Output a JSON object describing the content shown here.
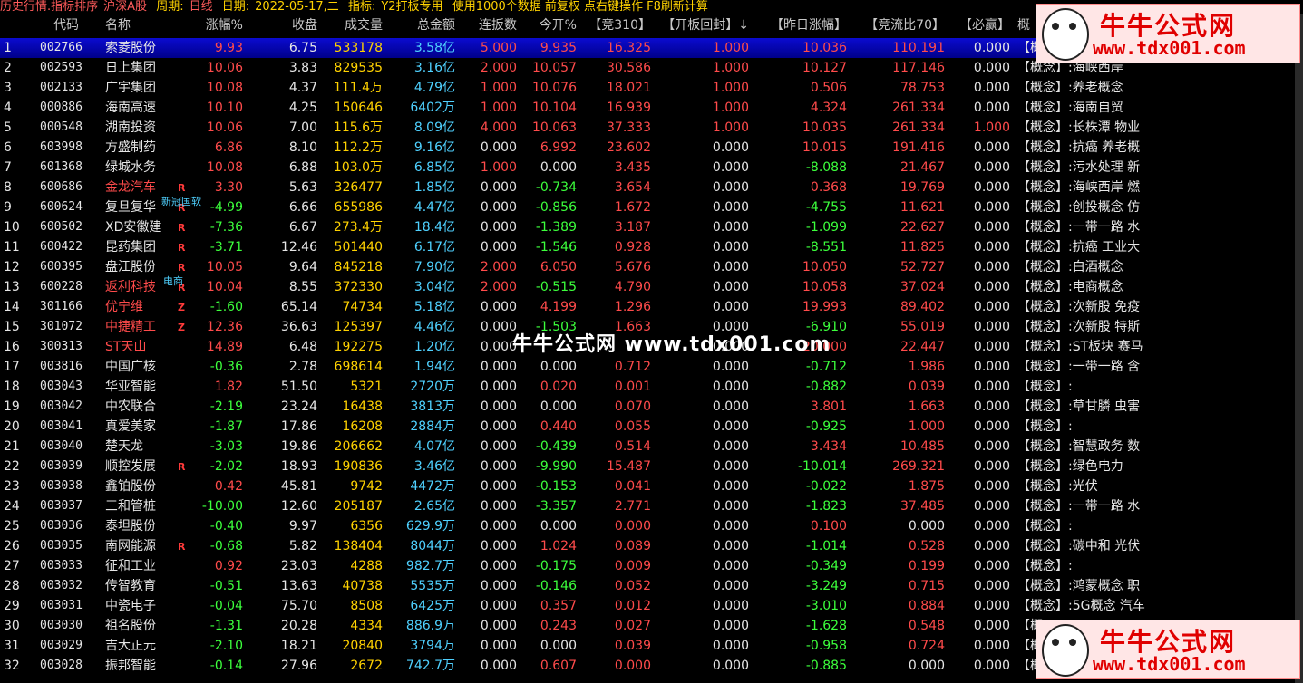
{
  "topbar": {
    "crumb": "历史行情.指标排序",
    "market": "沪深A股",
    "period_label": "周期:",
    "period_value": "日线",
    "date_label": "日期:",
    "date_value": "2022-05-17,二",
    "indicator_label": "指标:",
    "indicator_value": "Y2打板专用",
    "hint": "使用1000个数据 前复权 点右键操作 F8刷新计算"
  },
  "columns": [
    "代码",
    "名称",
    "涨幅%",
    "收盘",
    "成交量",
    "总金额",
    "连扳数",
    "今开%",
    "【竞310】",
    "【开板回封】↓",
    "【昨日涨幅】",
    "【竞流比70】",
    "【必赢】",
    "概"
  ],
  "rows": [
    [
      "1",
      "002766",
      "索菱股份",
      "9.93",
      "6.75",
      "533178",
      "3.58亿",
      "5.000",
      "9.935",
      "16.325",
      "1.000",
      "10.036",
      "110.191",
      "0.000",
      "【概"
    ],
    [
      "2",
      "002593",
      "日上集团",
      "10.06",
      "3.83",
      "829535",
      "3.16亿",
      "2.000",
      "10.057",
      "30.586",
      "1.000",
      "10.127",
      "117.146",
      "0.000",
      "【概念】:海峡西岸"
    ],
    [
      "3",
      "002133",
      "广宇集团",
      "10.08",
      "4.37",
      "111.4万",
      "4.79亿",
      "1.000",
      "10.076",
      "18.021",
      "1.000",
      "0.506",
      "78.753",
      "0.000",
      "【概念】:养老概念"
    ],
    [
      "4",
      "000886",
      "海南高速",
      "10.10",
      "4.25",
      "150646",
      "6402万",
      "1.000",
      "10.104",
      "16.939",
      "1.000",
      "4.324",
      "261.334",
      "0.000",
      "【概念】:海南自贸"
    ],
    [
      "5",
      "000548",
      "湖南投资",
      "10.06",
      "7.00",
      "115.6万",
      "8.09亿",
      "4.000",
      "10.063",
      "37.333",
      "1.000",
      "10.035",
      "261.334",
      "1.000",
      "【概念】:长株潭 物业"
    ],
    [
      "6",
      "603998",
      "方盛制药",
      "6.86",
      "8.10",
      "112.2万",
      "9.16亿",
      "0.000",
      "6.992",
      "23.602",
      "0.000",
      "10.015",
      "191.416",
      "0.000",
      "【概念】:抗癌 养老概"
    ],
    [
      "7",
      "601368",
      "绿城水务",
      "10.08",
      "6.88",
      "103.0万",
      "6.85亿",
      "1.000",
      "0.000",
      "3.435",
      "0.000",
      "-8.088",
      "21.467",
      "0.000",
      "【概念】:污水处理 新"
    ],
    [
      "8",
      "600686",
      "金龙汽车",
      "3.30",
      "5.63",
      "326477",
      "1.85亿",
      "0.000",
      "-0.734",
      "3.654",
      "0.000",
      "0.368",
      "19.769",
      "0.000",
      "【概念】:海峡西岸 燃"
    ],
    [
      "9",
      "600624",
      "复旦复华",
      "-4.99",
      "6.66",
      "655986",
      "4.47亿",
      "0.000",
      "-0.856",
      "1.672",
      "0.000",
      "-4.755",
      "11.621",
      "0.000",
      "【概念】:创投概念 仿"
    ],
    [
      "10",
      "600502",
      "XD安徽建",
      "-7.36",
      "6.67",
      "273.4万",
      "18.4亿",
      "0.000",
      "-1.389",
      "3.187",
      "0.000",
      "-1.099",
      "22.627",
      "0.000",
      "【概念】:一带一路 水"
    ],
    [
      "11",
      "600422",
      "昆药集团",
      "-3.71",
      "12.46",
      "501440",
      "6.17亿",
      "0.000",
      "-1.546",
      "0.928",
      "0.000",
      "-8.551",
      "11.825",
      "0.000",
      "【概念】:抗癌 工业大"
    ],
    [
      "12",
      "600395",
      "盘江股份",
      "10.05",
      "9.64",
      "845218",
      "7.90亿",
      "2.000",
      "6.050",
      "5.676",
      "0.000",
      "10.050",
      "52.727",
      "0.000",
      "【概念】:白酒概念"
    ],
    [
      "13",
      "600228",
      "返利科技",
      "10.04",
      "8.55",
      "372330",
      "3.04亿",
      "2.000",
      "-0.515",
      "4.790",
      "0.000",
      "10.058",
      "37.024",
      "0.000",
      "【概念】:电商概念"
    ],
    [
      "14",
      "301166",
      "优宁维",
      "-1.60",
      "65.14",
      "74734",
      "5.18亿",
      "0.000",
      "4.199",
      "1.296",
      "0.000",
      "19.993",
      "89.402",
      "0.000",
      "【概念】:次新股 免疫"
    ],
    [
      "15",
      "301072",
      "中捷精工",
      "12.36",
      "36.63",
      "125397",
      "4.46亿",
      "0.000",
      "-1.503",
      "1.663",
      "0.000",
      "-6.910",
      "55.019",
      "0.000",
      "【概念】:次新股 特斯"
    ],
    [
      "16",
      "300313",
      "ST天山",
      "14.89",
      "6.48",
      "192275",
      "1.20亿",
      "0.000",
      "",
      "",
      "0.000",
      "20.000",
      "22.447",
      "0.000",
      "【概念】:ST板块 赛马"
    ],
    [
      "17",
      "003816",
      "中国广核",
      "-0.36",
      "2.78",
      "698614",
      "1.94亿",
      "0.000",
      "0.000",
      "0.712",
      "0.000",
      "-0.712",
      "1.986",
      "0.000",
      "【概念】:一带一路 含"
    ],
    [
      "18",
      "003043",
      "华亚智能",
      "1.82",
      "51.50",
      "5321",
      "2720万",
      "0.000",
      "0.020",
      "0.001",
      "0.000",
      "-0.882",
      "0.039",
      "0.000",
      "【概念】:"
    ],
    [
      "19",
      "003042",
      "中农联合",
      "-2.19",
      "23.24",
      "16438",
      "3813万",
      "0.000",
      "0.000",
      "0.070",
      "0.000",
      "3.801",
      "1.663",
      "0.000",
      "【概念】:草甘膦 虫害"
    ],
    [
      "20",
      "003041",
      "真爱美家",
      "-1.87",
      "17.86",
      "16208",
      "2884万",
      "0.000",
      "0.440",
      "0.055",
      "0.000",
      "-0.925",
      "1.000",
      "0.000",
      "【概念】:"
    ],
    [
      "21",
      "003040",
      "楚天龙",
      "-3.03",
      "19.86",
      "206662",
      "4.07亿",
      "0.000",
      "-0.439",
      "0.514",
      "0.000",
      "3.434",
      "10.485",
      "0.000",
      "【概念】:智慧政务 数"
    ],
    [
      "22",
      "003039",
      "顺控发展",
      "-2.02",
      "18.93",
      "190836",
      "3.46亿",
      "0.000",
      "-9.990",
      "15.487",
      "0.000",
      "-10.014",
      "269.321",
      "0.000",
      "【概念】:绿色电力"
    ],
    [
      "23",
      "003038",
      "鑫铂股份",
      "0.42",
      "45.81",
      "9742",
      "4472万",
      "0.000",
      "-0.153",
      "0.041",
      "0.000",
      "-0.022",
      "1.875",
      "0.000",
      "【概念】:光伏"
    ],
    [
      "24",
      "003037",
      "三和管桩",
      "-10.00",
      "12.60",
      "205187",
      "2.65亿",
      "0.000",
      "-3.357",
      "2.771",
      "0.000",
      "-1.823",
      "37.485",
      "0.000",
      "【概念】:一带一路 水"
    ],
    [
      "25",
      "003036",
      "泰坦股份",
      "-0.40",
      "9.97",
      "6356",
      "629.9万",
      "0.000",
      "0.000",
      "0.000",
      "0.000",
      "0.100",
      "0.000",
      "0.000",
      "【概念】:"
    ],
    [
      "26",
      "003035",
      "南网能源",
      "-0.68",
      "5.82",
      "138404",
      "8044万",
      "0.000",
      "1.024",
      "0.089",
      "0.000",
      "-1.014",
      "0.528",
      "0.000",
      "【概念】:碳中和 光伏"
    ],
    [
      "27",
      "003033",
      "征和工业",
      "0.92",
      "23.03",
      "4288",
      "982.7万",
      "0.000",
      "-0.175",
      "0.009",
      "0.000",
      "-0.349",
      "0.199",
      "0.000",
      "【概念】:"
    ],
    [
      "28",
      "003032",
      "传智教育",
      "-0.51",
      "13.63",
      "40738",
      "5535万",
      "0.000",
      "-0.146",
      "0.052",
      "0.000",
      "-3.249",
      "0.715",
      "0.000",
      "【概念】:鸿蒙概念 职"
    ],
    [
      "29",
      "003031",
      "中瓷电子",
      "-0.04",
      "75.70",
      "8508",
      "6425万",
      "0.000",
      "0.357",
      "0.012",
      "0.000",
      "-3.010",
      "0.884",
      "0.000",
      "【概念】:5G概念 汽车"
    ],
    [
      "30",
      "003030",
      "祖名股份",
      "-1.31",
      "20.28",
      "4334",
      "886.9万",
      "0.000",
      "0.243",
      "0.027",
      "0.000",
      "-1.628",
      "0.548",
      "0.000",
      "【概"
    ],
    [
      "31",
      "003029",
      "吉大正元",
      "-2.10",
      "18.21",
      "20840",
      "3794万",
      "0.000",
      "0.000",
      "0.039",
      "0.000",
      "-0.958",
      "0.724",
      "0.000",
      "【概"
    ],
    [
      "32",
      "003028",
      "振邦智能",
      "-0.14",
      "27.96",
      "2672",
      "742.7万",
      "0.000",
      "0.607",
      "0.000",
      "0.000",
      "-0.885",
      "0.000",
      "0.000",
      "【概"
    ]
  ],
  "name_colors": {
    "8": "#ff4b4b",
    "10": "#e6e6e6",
    "13": "#ff4b4b",
    "14": "#ff4b4b",
    "15": "#ff4b4b",
    "16": "#ff4b4b"
  },
  "flags": [
    {
      "row": 8,
      "text": "R"
    },
    {
      "row": 9,
      "text": "R"
    },
    {
      "row": 10,
      "text": "R"
    },
    {
      "row": 11,
      "text": "R"
    },
    {
      "row": 12,
      "text": "R"
    },
    {
      "row": 13,
      "text": "R"
    },
    {
      "row": 14,
      "text": "Z"
    },
    {
      "row": 15,
      "text": "Z"
    },
    {
      "row": 22,
      "text": "R"
    },
    {
      "row": 26,
      "text": "R"
    }
  ],
  "tags": [
    {
      "row": 9,
      "text": "新冠国软"
    },
    {
      "row": 13,
      "text": "电商"
    }
  ],
  "watermark": "牛牛公式网 www.tdx001.com",
  "logo": {
    "brand": "牛牛公式网",
    "url": "www.tdx001.com"
  },
  "colors": {
    "positive": "#ff4b4b",
    "negative": "#3cff3c",
    "amount": "#4fd1ff",
    "volume": "#ffd200",
    "selected": "#0b0bd0"
  }
}
